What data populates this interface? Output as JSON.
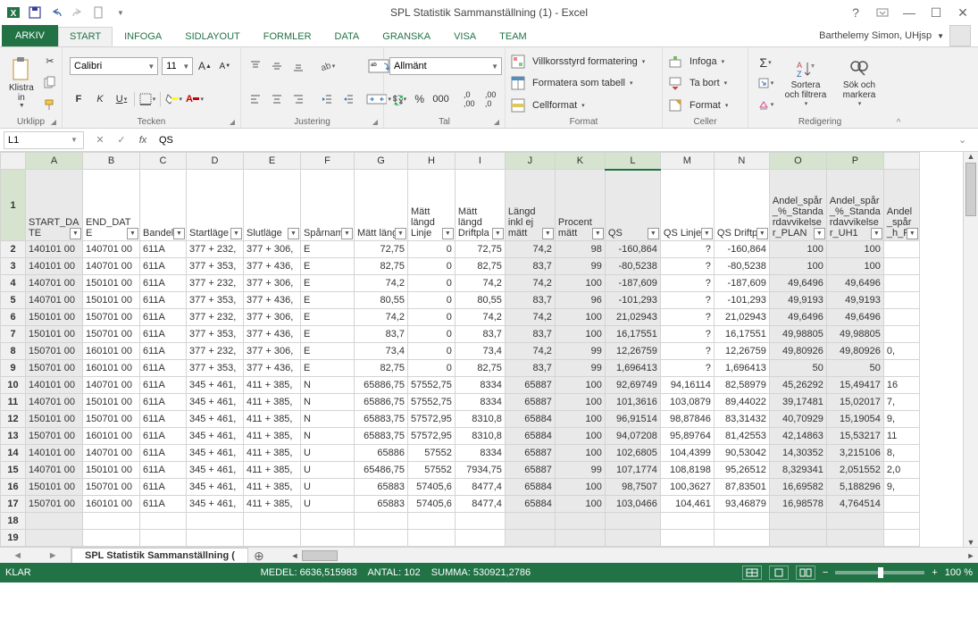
{
  "window": {
    "title": "SPL Statistik Sammanställning (1) - Excel"
  },
  "user": "Barthelemy Simon, UHjsp",
  "tabs": {
    "file": "ARKIV",
    "items": [
      "START",
      "INFOGA",
      "SIDLAYOUT",
      "FORMLER",
      "DATA",
      "GRANSKA",
      "VISA",
      "Team"
    ],
    "active": "START"
  },
  "ribbon": {
    "clipboard": {
      "paste": "Klistra in",
      "label": "Urklipp"
    },
    "font": {
      "name": "Calibri",
      "size": "11",
      "label": "Tecken",
      "bold": "F",
      "italic": "K",
      "underline": "U"
    },
    "align": {
      "label": "Justering"
    },
    "number": {
      "format": "Allmänt",
      "label": "Tal"
    },
    "styles": {
      "cond": "Villkorsstyrd formatering",
      "table": "Formatera som tabell",
      "cell": "Cellformat",
      "label": "Format"
    },
    "cells": {
      "insert": "Infoga",
      "delete": "Ta bort",
      "format": "Format",
      "label": "Celler"
    },
    "editing": {
      "sort": "Sortera och filtrera",
      "find": "Sök och markera",
      "label": "Redigering"
    }
  },
  "formula_bar": {
    "ref": "L1",
    "value": "QS"
  },
  "columns": [
    "A",
    "B",
    "C",
    "D",
    "E",
    "F",
    "G",
    "H",
    "I",
    "J",
    "K",
    "L",
    "M",
    "N",
    "O",
    "P",
    ""
  ],
  "selected_cols": [
    "A",
    "J",
    "K",
    "L",
    "O",
    "P"
  ],
  "active_col": "L",
  "headers": {
    "A": "START_DATE",
    "B": "END_DATE",
    "C": "Bandel",
    "D": "Startläge",
    "E": "Slutläge",
    "F": "Spårnamn",
    "G": "Mätt längd",
    "H": "Mätt längd Linje",
    "I": "Mätt längd Driftpla",
    "J": "Längd inkl ej mätt",
    "K": "Procent mätt",
    "L": "QS",
    "M": "QS Linje",
    "N": "QS Driftpla",
    "O": "Andel_spår_%_Standardavvikelser_PLAN",
    "P": "Andel_spår_%_Standardavvikelser_UH1",
    "Q": "Andel_spår_h_P"
  },
  "rows": [
    {
      "n": 2,
      "A": "140101 00",
      "B": "140701 00",
      "C": "611A",
      "D": "377 + 232,",
      "E": "377 + 306,",
      "F": "E",
      "G": "72,75",
      "H": "0",
      "I": "72,75",
      "J": "74,2",
      "K": "98",
      "L": "-160,864",
      "M": "?",
      "N": "-160,864",
      "O": "100",
      "P": "100",
      "Q": ""
    },
    {
      "n": 3,
      "A": "140101 00",
      "B": "140701 00",
      "C": "611A",
      "D": "377 + 353,",
      "E": "377 + 436,",
      "F": "E",
      "G": "82,75",
      "H": "0",
      "I": "82,75",
      "J": "83,7",
      "K": "99",
      "L": "-80,5238",
      "M": "?",
      "N": "-80,5238",
      "O": "100",
      "P": "100",
      "Q": ""
    },
    {
      "n": 4,
      "A": "140701 00",
      "B": "150101 00",
      "C": "611A",
      "D": "377 + 232,",
      "E": "377 + 306,",
      "F": "E",
      "G": "74,2",
      "H": "0",
      "I": "74,2",
      "J": "74,2",
      "K": "100",
      "L": "-187,609",
      "M": "?",
      "N": "-187,609",
      "O": "49,6496",
      "P": "49,6496",
      "Q": ""
    },
    {
      "n": 5,
      "A": "140701 00",
      "B": "150101 00",
      "C": "611A",
      "D": "377 + 353,",
      "E": "377 + 436,",
      "F": "E",
      "G": "80,55",
      "H": "0",
      "I": "80,55",
      "J": "83,7",
      "K": "96",
      "L": "-101,293",
      "M": "?",
      "N": "-101,293",
      "O": "49,9193",
      "P": "49,9193",
      "Q": ""
    },
    {
      "n": 6,
      "A": "150101 00",
      "B": "150701 00",
      "C": "611A",
      "D": "377 + 232,",
      "E": "377 + 306,",
      "F": "E",
      "G": "74,2",
      "H": "0",
      "I": "74,2",
      "J": "74,2",
      "K": "100",
      "L": "21,02943",
      "M": "?",
      "N": "21,02943",
      "O": "49,6496",
      "P": "49,6496",
      "Q": ""
    },
    {
      "n": 7,
      "A": "150101 00",
      "B": "150701 00",
      "C": "611A",
      "D": "377 + 353,",
      "E": "377 + 436,",
      "F": "E",
      "G": "83,7",
      "H": "0",
      "I": "83,7",
      "J": "83,7",
      "K": "100",
      "L": "16,17551",
      "M": "?",
      "N": "16,17551",
      "O": "49,98805",
      "P": "49,98805",
      "Q": ""
    },
    {
      "n": 8,
      "A": "150701 00",
      "B": "160101 00",
      "C": "611A",
      "D": "377 + 232,",
      "E": "377 + 306,",
      "F": "E",
      "G": "73,4",
      "H": "0",
      "I": "73,4",
      "J": "74,2",
      "K": "99",
      "L": "12,26759",
      "M": "?",
      "N": "12,26759",
      "O": "49,80926",
      "P": "49,80926",
      "Q": "0,"
    },
    {
      "n": 9,
      "A": "150701 00",
      "B": "160101 00",
      "C": "611A",
      "D": "377 + 353,",
      "E": "377 + 436,",
      "F": "E",
      "G": "82,75",
      "H": "0",
      "I": "82,75",
      "J": "83,7",
      "K": "99",
      "L": "1,696413",
      "M": "?",
      "N": "1,696413",
      "O": "50",
      "P": "50",
      "Q": ""
    },
    {
      "n": 10,
      "A": "140101 00",
      "B": "140701 00",
      "C": "611A",
      "D": "345 + 461,",
      "E": "411 + 385,",
      "F": "N",
      "G": "65886,75",
      "H": "57552,75",
      "I": "8334",
      "J": "65887",
      "K": "100",
      "L": "92,69749",
      "M": "94,16114",
      "N": "82,58979",
      "O": "45,26292",
      "P": "15,49417",
      "Q": "16"
    },
    {
      "n": 11,
      "A": "140701 00",
      "B": "150101 00",
      "C": "611A",
      "D": "345 + 461,",
      "E": "411 + 385,",
      "F": "N",
      "G": "65886,75",
      "H": "57552,75",
      "I": "8334",
      "J": "65887",
      "K": "100",
      "L": "101,3616",
      "M": "103,0879",
      "N": "89,44022",
      "O": "39,17481",
      "P": "15,02017",
      "Q": "7,"
    },
    {
      "n": 12,
      "A": "150101 00",
      "B": "150701 00",
      "C": "611A",
      "D": "345 + 461,",
      "E": "411 + 385,",
      "F": "N",
      "G": "65883,75",
      "H": "57572,95",
      "I": "8310,8",
      "J": "65884",
      "K": "100",
      "L": "96,91514",
      "M": "98,87846",
      "N": "83,31432",
      "O": "40,70929",
      "P": "15,19054",
      "Q": "9,"
    },
    {
      "n": 13,
      "A": "150701 00",
      "B": "160101 00",
      "C": "611A",
      "D": "345 + 461,",
      "E": "411 + 385,",
      "F": "N",
      "G": "65883,75",
      "H": "57572,95",
      "I": "8310,8",
      "J": "65884",
      "K": "100",
      "L": "94,07208",
      "M": "95,89764",
      "N": "81,42553",
      "O": "42,14863",
      "P": "15,53217",
      "Q": "11"
    },
    {
      "n": 14,
      "A": "140101 00",
      "B": "140701 00",
      "C": "611A",
      "D": "345 + 461,",
      "E": "411 + 385,",
      "F": "U",
      "G": "65886",
      "H": "57552",
      "I": "8334",
      "J": "65887",
      "K": "100",
      "L": "102,6805",
      "M": "104,4399",
      "N": "90,53042",
      "O": "14,30352",
      "P": "3,215106",
      "Q": "8,"
    },
    {
      "n": 15,
      "A": "140701 00",
      "B": "150101 00",
      "C": "611A",
      "D": "345 + 461,",
      "E": "411 + 385,",
      "F": "U",
      "G": "65486,75",
      "H": "57552",
      "I": "7934,75",
      "J": "65887",
      "K": "99",
      "L": "107,1774",
      "M": "108,8198",
      "N": "95,26512",
      "O": "8,329341",
      "P": "2,051552",
      "Q": "2,0"
    },
    {
      "n": 16,
      "A": "150101 00",
      "B": "150701 00",
      "C": "611A",
      "D": "345 + 461,",
      "E": "411 + 385,",
      "F": "U",
      "G": "65883",
      "H": "57405,6",
      "I": "8477,4",
      "J": "65884",
      "K": "100",
      "L": "98,7507",
      "M": "100,3627",
      "N": "87,83501",
      "O": "16,69582",
      "P": "5,188296",
      "Q": "9,"
    },
    {
      "n": 17,
      "A": "150701 00",
      "B": "160101 00",
      "C": "611A",
      "D": "345 + 461,",
      "E": "411 + 385,",
      "F": "U",
      "G": "65883",
      "H": "57405,6",
      "I": "8477,4",
      "J": "65884",
      "K": "100",
      "L": "103,0466",
      "M": "104,461",
      "N": "93,46879",
      "O": "16,98578",
      "P": "4,764514",
      "Q": ""
    },
    {
      "n": 18,
      "A": "",
      "B": "",
      "C": "",
      "D": "",
      "E": "",
      "F": "",
      "G": "",
      "H": "",
      "I": "",
      "J": "",
      "K": "",
      "L": "",
      "M": "",
      "N": "",
      "O": "",
      "P": "",
      "Q": ""
    },
    {
      "n": 19,
      "A": "",
      "B": "",
      "C": "",
      "D": "",
      "E": "",
      "F": "",
      "G": "",
      "H": "",
      "I": "",
      "J": "",
      "K": "",
      "L": "",
      "M": "",
      "N": "",
      "O": "",
      "P": "",
      "Q": ""
    }
  ],
  "sheet": {
    "name": "SPL Statistik Sammanställning ("
  },
  "status": {
    "state": "KLAR",
    "avg": "MEDEL: 6636,515983",
    "count": "ANTAL: 102",
    "sum": "SUMMA: 530921,2786",
    "zoom": "100 %"
  }
}
